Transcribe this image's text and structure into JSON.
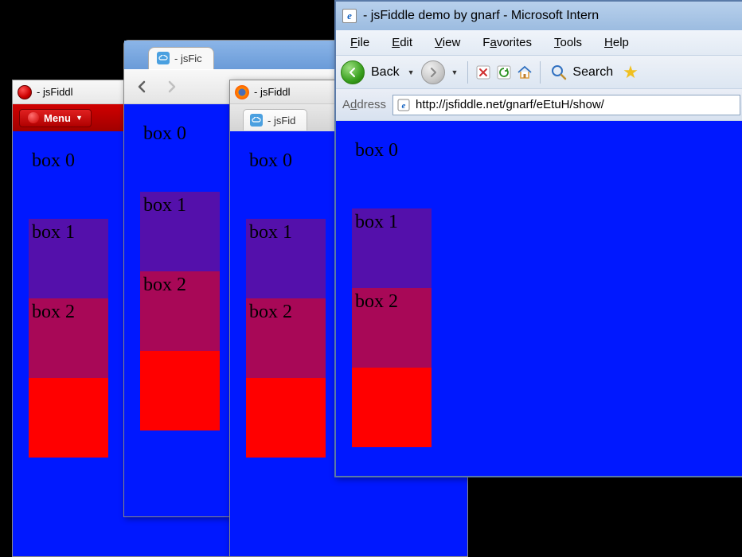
{
  "opera": {
    "title": "- jsFiddl",
    "menu_label": "Menu"
  },
  "chrome": {
    "tab_title": "- jsFic"
  },
  "firefox": {
    "title": "- jsFiddl",
    "tab_title": "- jsFid"
  },
  "ie": {
    "title": "- jsFiddle demo by gnarf - Microsoft Intern",
    "menus": {
      "file": {
        "letter": "F",
        "rest": "ile"
      },
      "edit": {
        "letter": "E",
        "rest": "dit"
      },
      "view": {
        "letter": "V",
        "rest": "iew"
      },
      "favorites": {
        "letter": "a",
        "pre": "F",
        "rest": "vorites"
      },
      "tools": {
        "letter": "T",
        "rest": "ools"
      },
      "help": {
        "letter": "H",
        "rest": "elp"
      }
    },
    "back_label": "Back",
    "search_label": "Search",
    "address_label": {
      "letter": "d",
      "pre": "A",
      "rest": "dress"
    },
    "url": "http://jsfiddle.net/gnarf/eEtuH/show/"
  },
  "content": {
    "boxes": [
      "box 0",
      "box 1",
      "box 2",
      ""
    ]
  }
}
